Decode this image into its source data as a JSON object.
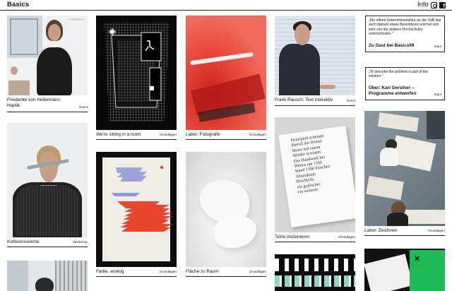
{
  "header": {
    "site_title": "Basics",
    "info_label": "Info",
    "social": [
      "instagram-icon",
      "facebook-icon"
    ]
  },
  "cards": {
    "friederike": {
      "title": "Friederike von Hellermann: Haptik",
      "tag": "Event"
    },
    "kollisionswoche": {
      "title": "Kollisionswoche",
      "tag": "Workshop"
    },
    "sitting": {
      "title": "We’re sitting in a room",
      "tag": "Grundlagen"
    },
    "farbe": {
      "title": "Farbe, analog",
      "tag": "Grundlagen"
    },
    "fotografie": {
      "title": "Labor: Fotografie",
      "tag": "Grundlagen"
    },
    "flaeche": {
      "title": "Fläche zu Raum",
      "tag": "Grundlagen"
    },
    "rausch": {
      "title": "Frank Rausch: Text interaktiv",
      "tag": "Event"
    },
    "texte": {
      "title": "Texte inszenieren",
      "tag": "Grundlagen"
    },
    "zeichnen": {
      "title": "Labor: Zeichnen",
      "tag": "Grundlagen"
    }
  },
  "quotes": {
    "q1": {
      "quote": "„Die offene Unterrichtsstruktur an der UdK war auch damals etwas Besonderes und hat sich sehr von der anderer Hochschulen unterschieden.“",
      "title": "Zu Gast bei Basics09",
      "tag": "Input"
    },
    "q2": {
      "quote": "„To describe the problem is part of the solution.“",
      "title": "Über: Karl Gerstner – Programme entwerfen",
      "tag": "Input"
    }
  },
  "book_text": [
    "Prinzipiell scheinen",
    "überall die Wörter",
    "Worte mit einem",
    "Wieder in einem",
    "Das Handwerk bei",
    "Weiten um 1300",
    "Wand 1300 Flaschen",
    "Abstraktion",
    "Bruchteile",
    "ein grafischer",
    "ein weiteres"
  ],
  "colors": {
    "accent_red": "#e23a2f",
    "teal": "#8fd5c4",
    "green": "#1dbb55"
  }
}
